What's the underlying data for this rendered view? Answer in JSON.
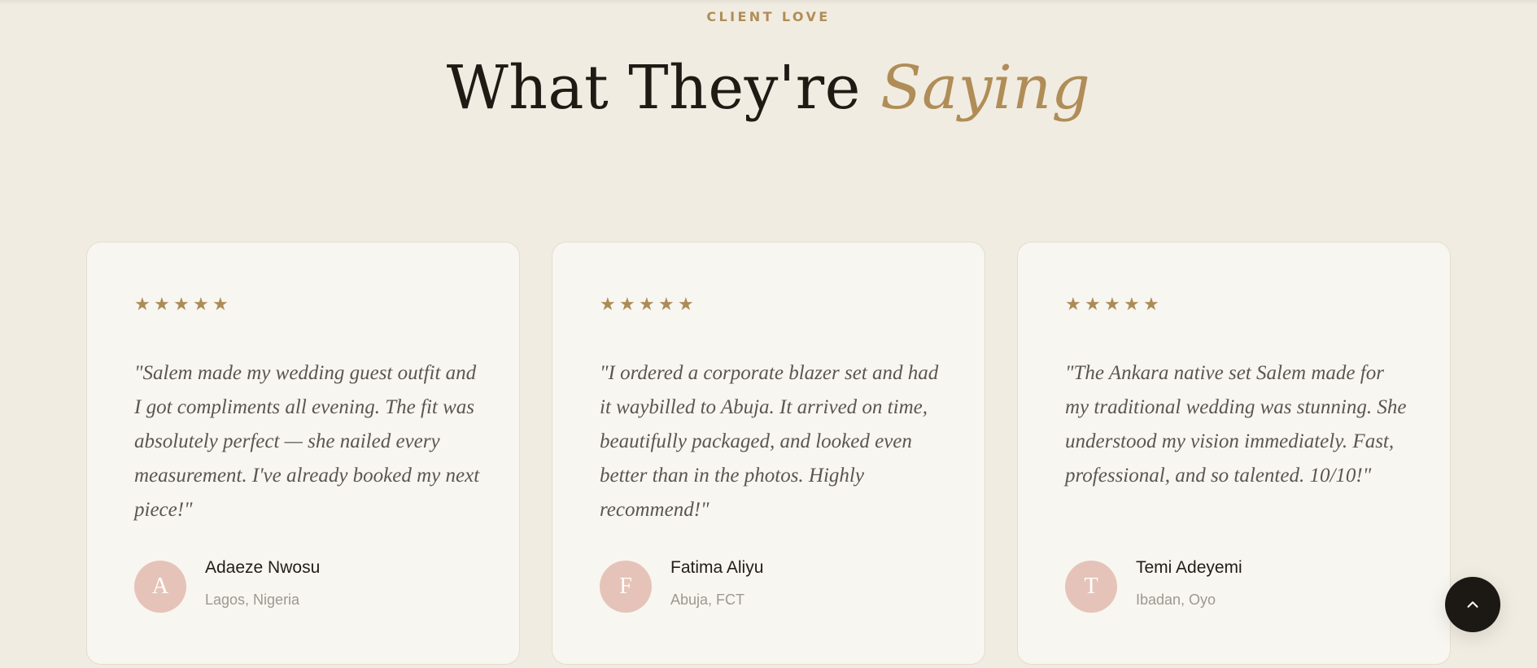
{
  "header": {
    "eyebrow": "CLIENT LOVE",
    "title_main": "What They're",
    "title_accent": "Saying"
  },
  "colors": {
    "background": "#f1ece1",
    "card": "#f8f6f1",
    "accent_gold": "#b08d57",
    "avatar_pink": "#e6c3b8",
    "dark": "#1c1814"
  },
  "testimonials": [
    {
      "rating": 5,
      "quote": "\"Salem made my wedding guest outfit and I got compliments all evening. The fit was absolutely perfect — she nailed every measurement. I've already booked my next piece!\"",
      "initial": "A",
      "name": "Adaeze Nwosu",
      "location": "Lagos, Nigeria"
    },
    {
      "rating": 5,
      "quote": "\"I ordered a corporate blazer set and had it waybilled to Abuja. It arrived on time, beautifully packaged, and looked even better than in the photos. Highly recommend!\"",
      "initial": "F",
      "name": "Fatima Aliyu",
      "location": "Abuja, FCT"
    },
    {
      "rating": 5,
      "quote": "\"The Ankara native set Salem made for my traditional wedding was stunning. She understood my vision immediately. Fast, professional, and so talented. 10/10!\"",
      "initial": "T",
      "name": "Temi Adeyemi",
      "location": "Ibadan, Oyo"
    }
  ],
  "back_to_top": {
    "icon": "chevron-up-icon"
  }
}
